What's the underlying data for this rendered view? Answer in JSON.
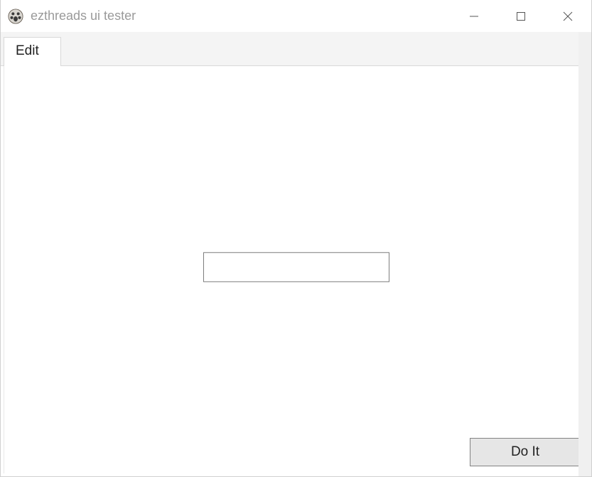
{
  "window": {
    "title": "ezthreads ui tester"
  },
  "tabs": [
    {
      "label": "Edit"
    }
  ],
  "main": {
    "input_value": "",
    "input_placeholder": ""
  },
  "buttons": {
    "do_it_label": "Do It"
  }
}
